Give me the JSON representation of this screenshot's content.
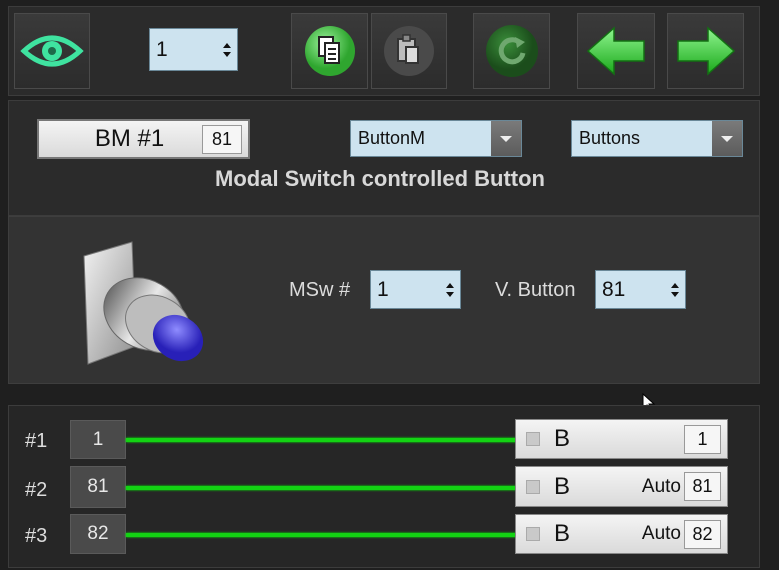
{
  "toolbar": {
    "page_spinner": "1",
    "icons": [
      "eye-icon",
      "copy-icon",
      "paste-icon",
      "refresh-icon",
      "arrow-left-icon",
      "arrow-right-icon"
    ]
  },
  "header": {
    "bm_label": "BM #1",
    "bm_value": "81",
    "type_dropdown": "ButtonM",
    "category_dropdown": "Buttons",
    "title": "Modal Switch controlled Button"
  },
  "config": {
    "msw_label": "MSw #",
    "msw_value": "1",
    "vbutton_label": "V. Button",
    "vbutton_value": "81"
  },
  "connections": [
    {
      "label": "#1",
      "input": "1",
      "button_label": "B",
      "auto": "",
      "value": "1"
    },
    {
      "label": "#2",
      "input": "81",
      "button_label": "B",
      "auto": "Auto",
      "value": "81"
    },
    {
      "label": "#3",
      "input": "82",
      "button_label": "B",
      "auto": "Auto",
      "value": "82"
    }
  ],
  "colors": {
    "accent_green": "#13d313",
    "field_blue": "#cde3ef"
  }
}
